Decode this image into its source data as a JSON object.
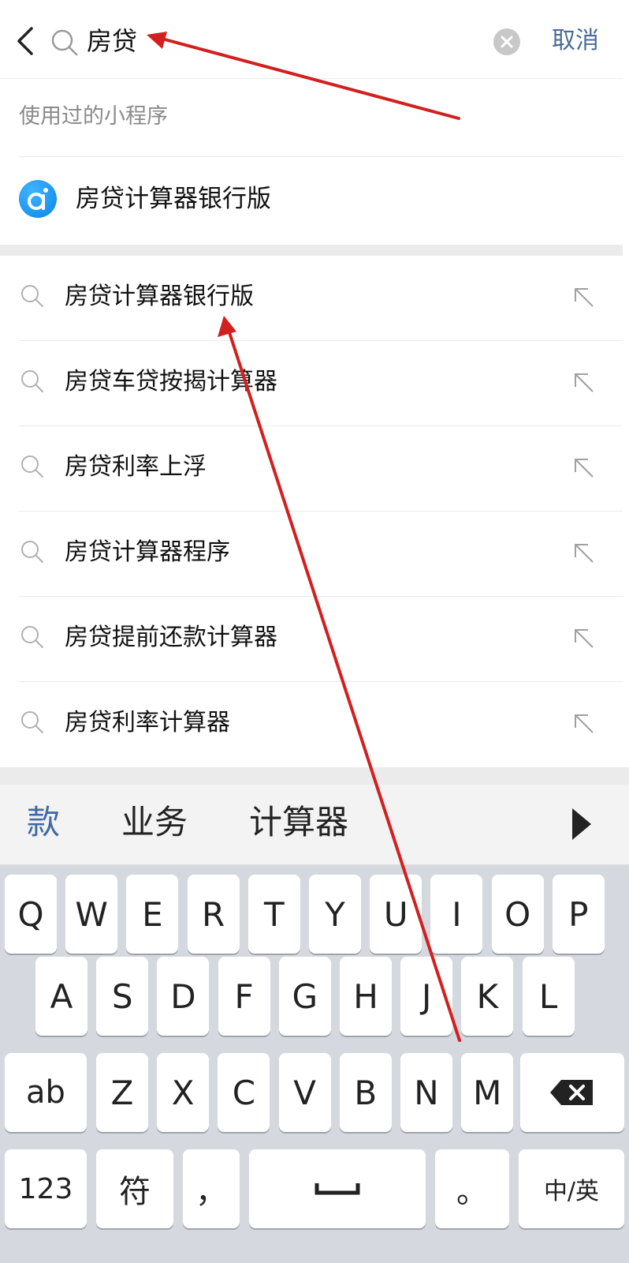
{
  "search": {
    "value": "房贷",
    "cancel_label": "取消"
  },
  "mini_programs": {
    "header": "使用过的小程序",
    "items": [
      {
        "label": "房贷计算器银行版"
      }
    ]
  },
  "suggestions": [
    {
      "text": "房贷计算器银行版"
    },
    {
      "text": "房贷车贷按揭计算器"
    },
    {
      "text": "房贷利率上浮"
    },
    {
      "text": "房贷计算器程序"
    },
    {
      "text": "房贷提前还款计算器"
    },
    {
      "text": "房贷利率计算器"
    }
  ],
  "keyboard": {
    "candidates": [
      "款",
      "业务",
      "计算器"
    ],
    "row1": [
      "Q",
      "W",
      "E",
      "R",
      "T",
      "Y",
      "U",
      "I",
      "O",
      "P"
    ],
    "row2": [
      "A",
      "S",
      "D",
      "F",
      "G",
      "H",
      "J",
      "K",
      "L"
    ],
    "row3": [
      "ab",
      "Z",
      "X",
      "C",
      "V",
      "B",
      "N",
      "M"
    ],
    "row4": {
      "num": "123",
      "sym": "符",
      "comma": "，",
      "period": "。",
      "lang": "中/英"
    }
  },
  "colors": {
    "accent_blue": "#4a6b96",
    "candidate_highlight": "#3f6aa8",
    "annotation_red": "#d21f1f",
    "keyboard_bg": "#d5d8de"
  },
  "icons": {
    "back": "chevron-left-icon",
    "search": "magnifier-icon",
    "clear": "clear-circle-icon",
    "fill_arrow": "arrow-up-left-icon",
    "backspace": "backspace-icon",
    "space": "space-bar-icon",
    "more": "triangle-right-icon"
  }
}
